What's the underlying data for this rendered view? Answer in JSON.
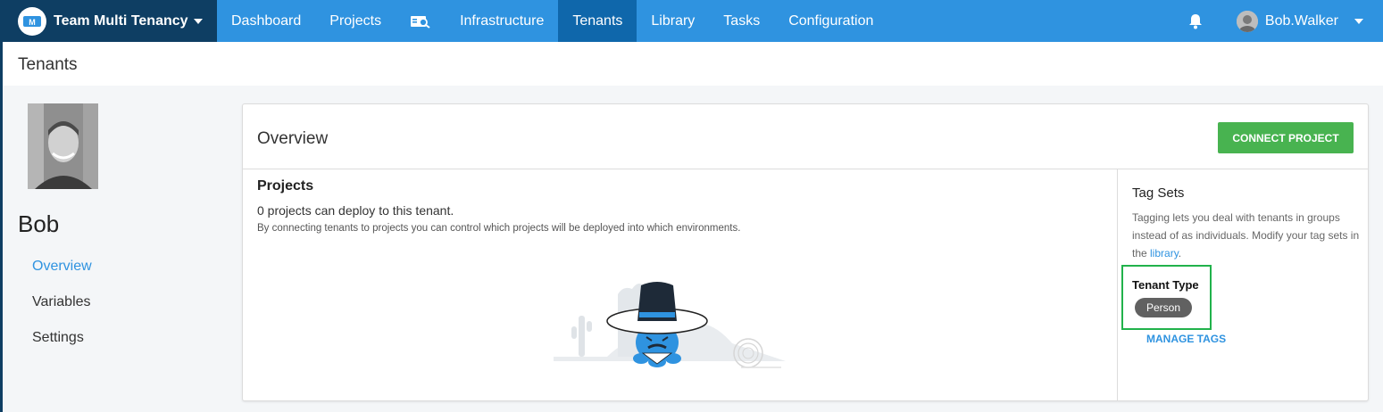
{
  "topbar": {
    "space_name": "Team Multi Tenancy",
    "nav": [
      "Dashboard",
      "Projects",
      "Infrastructure",
      "Tenants",
      "Library",
      "Tasks",
      "Configuration"
    ],
    "active_nav": "Tenants",
    "user_name": "Bob.Walker",
    "colors": {
      "bar": "#2f93e0",
      "active": "#0f67ab",
      "space": "#0e3e63"
    }
  },
  "page": {
    "title": "Tenants"
  },
  "sidebar": {
    "tenant_name": "Bob",
    "links": [
      {
        "label": "Overview",
        "active": true
      },
      {
        "label": "Variables",
        "active": false
      },
      {
        "label": "Settings",
        "active": false
      }
    ]
  },
  "overview": {
    "title": "Overview",
    "connect_button": "CONNECT PROJECT",
    "projects": {
      "title": "Projects",
      "count_text": "0 projects can deploy to this tenant.",
      "help_text": "By connecting tenants to projects you can control which projects will be deployed into which environments."
    },
    "tag_sets": {
      "title": "Tag Sets",
      "help_before_link": "Tagging lets you deal with tenants in groups instead of as individuals. Modify your tag sets in the ",
      "link_text": "library",
      "help_after_link": ".",
      "tag_type_label": "Tenant Type",
      "tag_value": "Person",
      "manage_link": "MANAGE TAGS"
    }
  }
}
